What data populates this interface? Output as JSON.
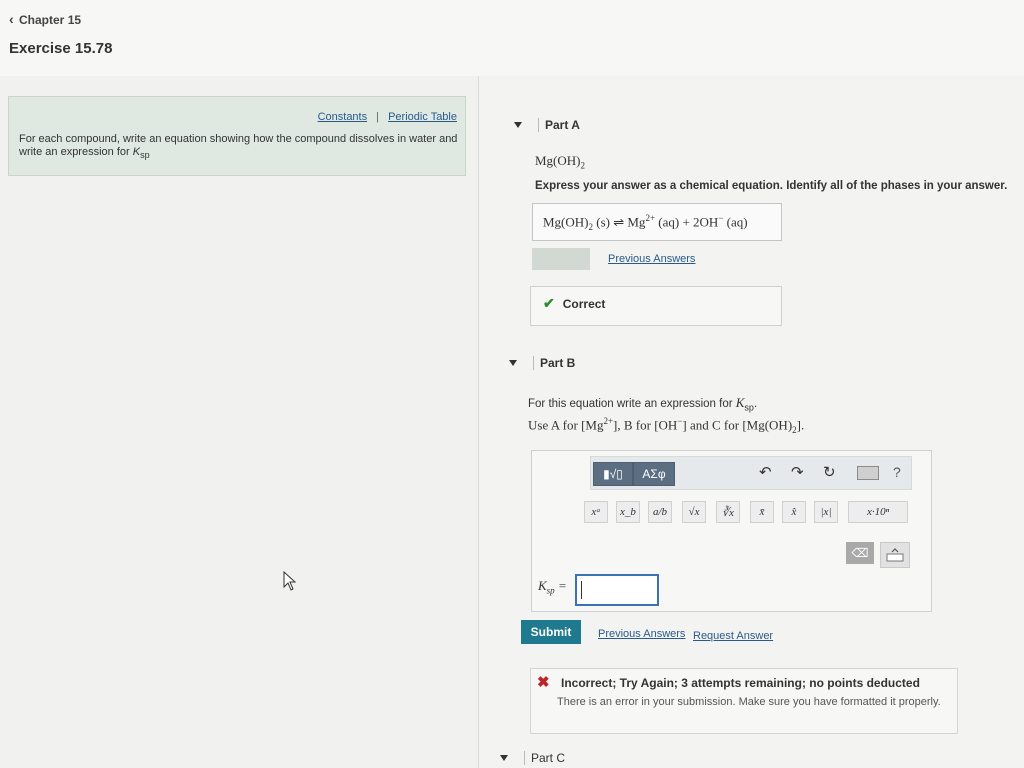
{
  "header": {
    "back_label": "Chapter 15",
    "exercise_title": "Exercise 15.78"
  },
  "prompt": {
    "link_constants": "Constants",
    "link_separator": "|",
    "link_periodic": "Periodic Table",
    "text": "For each compound, write an equation showing how the compound dissolves in water and write an expression for",
    "ksp_symbol": "K",
    "ksp_sub": "sp"
  },
  "part_a": {
    "label": "Part A",
    "compound_main": "Mg(OH)",
    "compound_sub": "2",
    "instruction": "Express your answer as a chemical equation. Identify all of the phases in your answer.",
    "answer": {
      "t1": "Mg(OH)",
      "t1_sub": "2",
      "t2": "(s)",
      "arrow": "⇌",
      "t3": "Mg",
      "t3_sup": "2+",
      "t4": "(aq) + 2OH",
      "t4_sup": "−",
      "t5": "(aq)"
    },
    "previous_answers": "Previous Answers",
    "status": "Correct"
  },
  "part_b": {
    "label": "Part B",
    "line1_prefix": "For this equation write an expression for",
    "ksp_symbol": "K",
    "ksp_sub": "sp",
    "line2": {
      "a": "Use A for [Mg",
      "a_sup": "2+",
      "b": "], B for [OH",
      "b_sup": "−",
      "c": "] and C for [Mg(OH)",
      "c_sub": "2",
      "d": "]."
    },
    "toolbar": {
      "template_button": "▮√▯",
      "greek_button": "ΑΣφ",
      "undo_icon": "↶",
      "redo_icon": "↷",
      "reset_icon": "↻",
      "help": "?"
    },
    "templates": [
      "xᵃ",
      "x_b",
      "a/b",
      "√x",
      "∛x",
      "x̄",
      "x̂",
      "|x|",
      "x·10ⁿ"
    ],
    "backspace_icon": "⌫",
    "ksp_label": "K",
    "ksp_label_sub": "sp",
    "ksp_equals": "=",
    "submit_label": "Submit",
    "previous_answers": "Previous Answers",
    "request_answer": "Request Answer",
    "feedback_title": "Incorrect; Try Again; 3 attempts remaining; no points deducted",
    "feedback_body": "There is an error in your submission. Make sure you have formatted it properly."
  },
  "part_c": {
    "label": "Part C"
  },
  "colors": {
    "submit": "#1f7a8f",
    "correct_check": "#2e8b2e",
    "incorrect_x": "#c0242a",
    "prompt_bg": "#dfe9e2",
    "input_border": "#3a72b8"
  }
}
